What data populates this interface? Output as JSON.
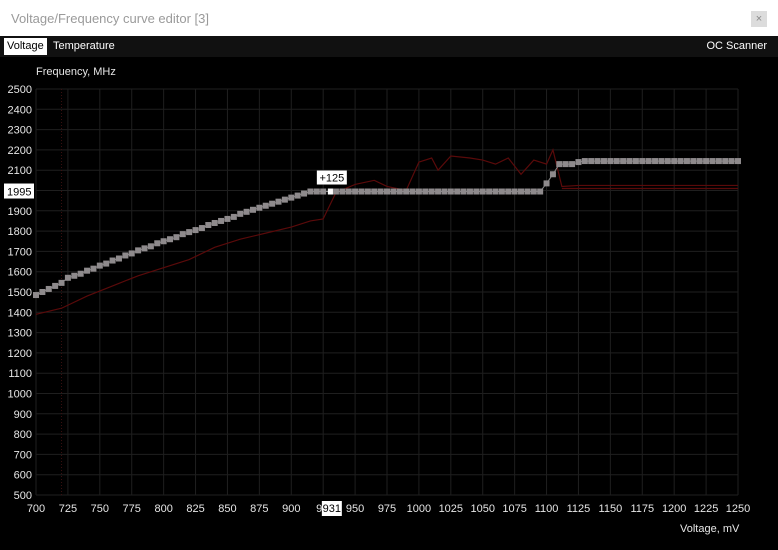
{
  "window": {
    "title": "Voltage/Frequency curve editor [3]",
    "close_glyph": "×"
  },
  "tabs": {
    "voltage": "Voltage",
    "temperature": "Temperature",
    "oc_scanner": "OC Scanner"
  },
  "chart_data": {
    "type": "line",
    "ylabel": "Frequency, MHz",
    "xlabel": "Voltage, mV",
    "xlim": [
      700,
      1250
    ],
    "ylim": [
      500,
      2500
    ],
    "x_ticks": [
      700,
      725,
      750,
      775,
      800,
      825,
      850,
      875,
      900,
      925,
      950,
      975,
      1000,
      1025,
      1050,
      1075,
      1100,
      1125,
      1150,
      1175,
      1200,
      1225,
      1250
    ],
    "y_ticks": [
      500,
      600,
      700,
      800,
      900,
      1000,
      1100,
      1200,
      1300,
      1400,
      1500,
      1600,
      1700,
      1800,
      1900,
      2000,
      2100,
      2200,
      2300,
      2400,
      2500
    ],
    "grid": true,
    "colors": {
      "curve": "#8c8c8c",
      "point": "#8e8a8c",
      "selected": "#ffffff",
      "monitor": "#5a0a0a",
      "grid": "#1f1f1f"
    },
    "highlight": {
      "y_value": 1995,
      "x_value": 931,
      "x_tick_label": "931",
      "y_tick_label": "1995",
      "offset_label": "+125"
    },
    "series": [
      {
        "points": [
          [
            700,
            1485
          ],
          [
            705,
            1500
          ],
          [
            710,
            1515
          ],
          [
            715,
            1530
          ],
          [
            720,
            1545
          ],
          [
            725,
            1570
          ],
          [
            730,
            1580
          ],
          [
            735,
            1590
          ],
          [
            740,
            1605
          ],
          [
            745,
            1615
          ],
          [
            750,
            1630
          ],
          [
            755,
            1640
          ],
          [
            760,
            1655
          ],
          [
            765,
            1665
          ],
          [
            770,
            1680
          ],
          [
            775,
            1690
          ],
          [
            780,
            1705
          ],
          [
            785,
            1715
          ],
          [
            790,
            1725
          ],
          [
            795,
            1740
          ],
          [
            800,
            1750
          ],
          [
            805,
            1760
          ],
          [
            810,
            1770
          ],
          [
            815,
            1785
          ],
          [
            820,
            1795
          ],
          [
            825,
            1805
          ],
          [
            830,
            1815
          ],
          [
            835,
            1830
          ],
          [
            840,
            1840
          ],
          [
            845,
            1850
          ],
          [
            850,
            1860
          ],
          [
            855,
            1870
          ],
          [
            860,
            1885
          ],
          [
            865,
            1895
          ],
          [
            870,
            1905
          ],
          [
            875,
            1915
          ],
          [
            880,
            1925
          ],
          [
            885,
            1935
          ],
          [
            890,
            1945
          ],
          [
            895,
            1955
          ],
          [
            900,
            1965
          ],
          [
            905,
            1975
          ],
          [
            910,
            1985
          ],
          [
            915,
            1995
          ],
          [
            920,
            1995
          ],
          [
            925,
            1995
          ],
          [
            931,
            1995
          ],
          [
            935,
            1995
          ],
          [
            940,
            1995
          ],
          [
            945,
            1995
          ],
          [
            950,
            1995
          ],
          [
            955,
            1995
          ],
          [
            960,
            1995
          ],
          [
            965,
            1995
          ],
          [
            970,
            1995
          ],
          [
            975,
            1995
          ],
          [
            980,
            1995
          ],
          [
            985,
            1995
          ],
          [
            990,
            1995
          ],
          [
            995,
            1995
          ],
          [
            1000,
            1995
          ],
          [
            1005,
            1995
          ],
          [
            1010,
            1995
          ],
          [
            1015,
            1995
          ],
          [
            1020,
            1995
          ],
          [
            1025,
            1995
          ],
          [
            1030,
            1995
          ],
          [
            1035,
            1995
          ],
          [
            1040,
            1995
          ],
          [
            1045,
            1995
          ],
          [
            1050,
            1995
          ],
          [
            1055,
            1995
          ],
          [
            1060,
            1995
          ],
          [
            1065,
            1995
          ],
          [
            1070,
            1995
          ],
          [
            1075,
            1995
          ],
          [
            1080,
            1995
          ],
          [
            1085,
            1995
          ],
          [
            1090,
            1995
          ],
          [
            1095,
            1995
          ],
          [
            1100,
            2035
          ],
          [
            1105,
            2080
          ],
          [
            1110,
            2130
          ],
          [
            1115,
            2130
          ],
          [
            1120,
            2130
          ],
          [
            1125,
            2140
          ],
          [
            1130,
            2145
          ],
          [
            1135,
            2145
          ],
          [
            1140,
            2145
          ],
          [
            1145,
            2145
          ],
          [
            1150,
            2145
          ],
          [
            1155,
            2145
          ],
          [
            1160,
            2145
          ],
          [
            1165,
            2145
          ],
          [
            1170,
            2145
          ],
          [
            1175,
            2145
          ],
          [
            1180,
            2145
          ],
          [
            1185,
            2145
          ],
          [
            1190,
            2145
          ],
          [
            1195,
            2145
          ],
          [
            1200,
            2145
          ],
          [
            1205,
            2145
          ],
          [
            1210,
            2145
          ],
          [
            1215,
            2145
          ],
          [
            1220,
            2145
          ],
          [
            1225,
            2145
          ],
          [
            1230,
            2145
          ],
          [
            1235,
            2145
          ],
          [
            1240,
            2145
          ],
          [
            1245,
            2145
          ],
          [
            1250,
            2145
          ]
        ]
      },
      {
        "points": [
          [
            700,
            1390
          ],
          [
            720,
            1420
          ],
          [
            740,
            1480
          ],
          [
            760,
            1530
          ],
          [
            780,
            1580
          ],
          [
            800,
            1620
          ],
          [
            820,
            1660
          ],
          [
            840,
            1720
          ],
          [
            860,
            1760
          ],
          [
            880,
            1790
          ],
          [
            900,
            1820
          ],
          [
            915,
            1850
          ],
          [
            925,
            1860
          ],
          [
            935,
            1990
          ],
          [
            950,
            2030
          ],
          [
            965,
            2050
          ],
          [
            975,
            2020
          ],
          [
            990,
            2000
          ],
          [
            1000,
            2140
          ],
          [
            1010,
            2160
          ],
          [
            1015,
            2100
          ],
          [
            1025,
            2170
          ],
          [
            1040,
            2160
          ],
          [
            1050,
            2150
          ],
          [
            1060,
            2130
          ],
          [
            1070,
            2160
          ],
          [
            1080,
            2080
          ],
          [
            1090,
            2150
          ],
          [
            1100,
            2130
          ],
          [
            1105,
            2200
          ],
          [
            1112,
            2020
          ],
          [
            1125,
            2025
          ],
          [
            1150,
            2025
          ],
          [
            1250,
            2025
          ]
        ]
      },
      {
        "points": [
          [
            1112,
            2010
          ],
          [
            1150,
            2010
          ],
          [
            1250,
            2010
          ]
        ]
      }
    ]
  }
}
